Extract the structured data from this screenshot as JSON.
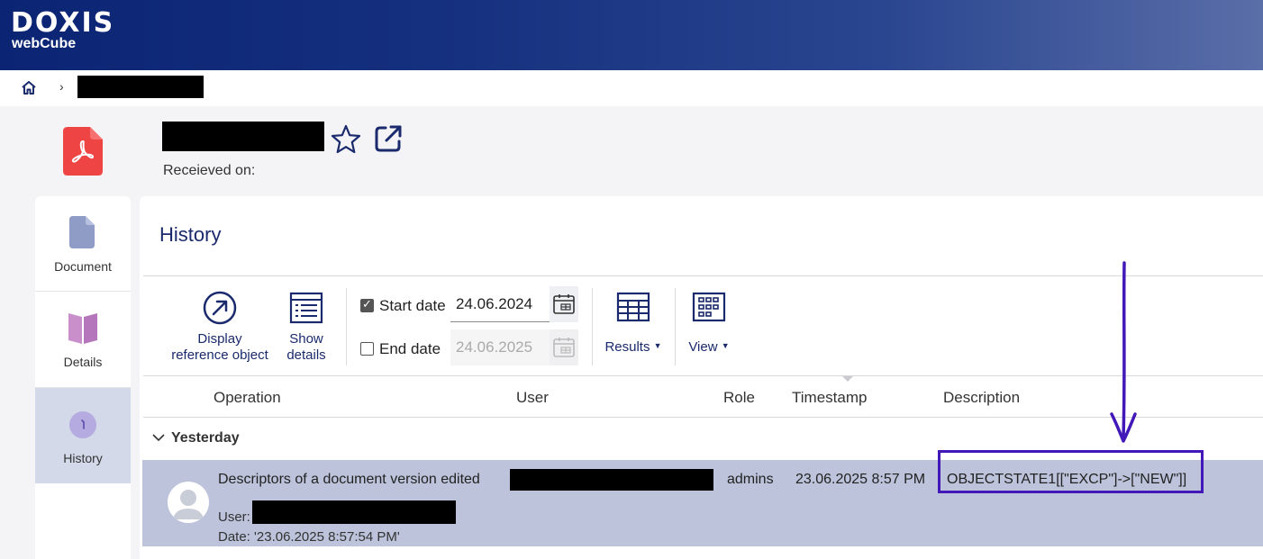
{
  "header": {
    "logo_main": "DOXIS",
    "logo_sub": "webCube"
  },
  "breadcrumb": {
    "separator": "›"
  },
  "document": {
    "received_label": "Receieved on:"
  },
  "sidenav": {
    "items": [
      {
        "label": "Document",
        "icon": "document-icon"
      },
      {
        "label": "Details",
        "icon": "details-book-icon"
      },
      {
        "label": "History",
        "icon": "history-clock-icon",
        "active": true
      }
    ]
  },
  "panel": {
    "title": "History"
  },
  "toolbar": {
    "display_reference_label_1": "Display",
    "display_reference_label_2": "reference object",
    "show_details_label_1": "Show",
    "show_details_label_2": "details",
    "start_date_label": "Start date",
    "start_date_value": "24.06.2024",
    "start_date_checked": true,
    "end_date_label": "End date",
    "end_date_value": "24.06.2025",
    "end_date_checked": false,
    "results_label": "Results",
    "view_label": "View"
  },
  "table": {
    "columns": [
      "Operation",
      "User",
      "Role",
      "Timestamp",
      "Description"
    ],
    "groups": [
      {
        "label": "Yesterday",
        "rows": [
          {
            "operation": "Descriptors of a document version edited",
            "role": "admins",
            "timestamp": "23.06.2025 8:57 PM",
            "description": "OBJECTSTATE1[[\"EXCP\"]->[\"NEW\"]]",
            "user_label": "User:",
            "date_line": "Date: '23.06.2025 8:57:54 PM'"
          }
        ]
      }
    ]
  },
  "colors": {
    "header_start": "#0b2574",
    "header_end": "#5a6ea8",
    "accent": "#1a2a6c",
    "row_selected": "#bcc3da",
    "annotation": "#4318b8",
    "pdf_red": "#ef4444"
  }
}
